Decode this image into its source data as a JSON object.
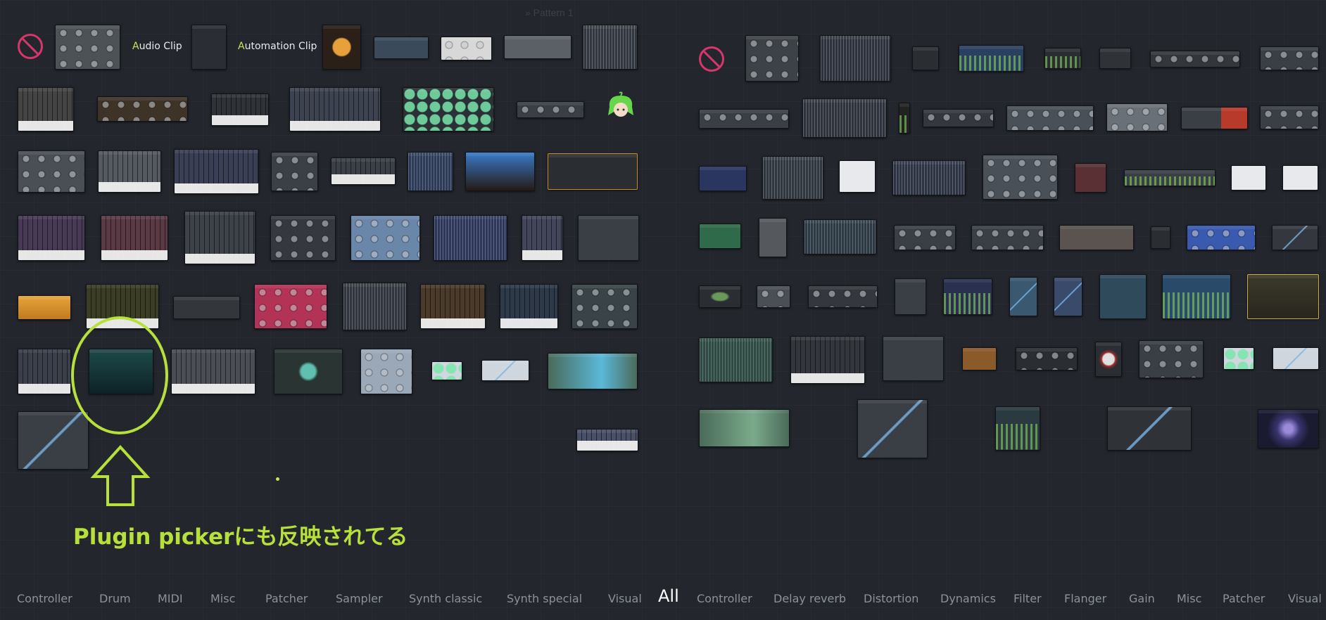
{
  "window": {
    "pattern_title": "» Pattern 1"
  },
  "left_panel": {
    "clip_labels": [
      {
        "first_letter": "A",
        "rest": "udio Clip"
      },
      {
        "first_letter": "A",
        "rest": "utomation Clip"
      }
    ]
  },
  "annotation": {
    "text": "Plugin pickerにも反映されてる",
    "color": "#b7e03a"
  },
  "bottom_tabs": {
    "active": "All",
    "left": [
      "Controller",
      "Drum",
      "MIDI",
      "Misc",
      "Patcher",
      "Sampler",
      "Synth classic",
      "Synth special",
      "Visual"
    ],
    "center": "All",
    "right": [
      "Controller",
      "Delay reverb",
      "Distortion",
      "Dynamics",
      "Filter",
      "Flanger",
      "Gain",
      "Misc",
      "Patcher",
      "Visual"
    ]
  },
  "colors": {
    "background": "#23272d",
    "accent_green": "#b7e03a",
    "no_icon": "#d6366b"
  },
  "icons": {
    "no_plugin": "no-entry-icon",
    "mascot": "mascot-icon",
    "arrow": "up-arrow-icon"
  }
}
